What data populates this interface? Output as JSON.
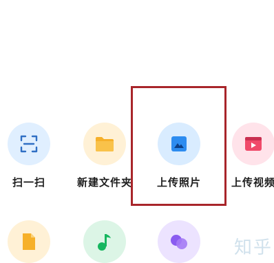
{
  "actions": [
    {
      "label": "扫一扫",
      "icon": "scan-icon",
      "bg": "#e0efff",
      "fg": "#2f6fc4"
    },
    {
      "label": "新建文件夹",
      "icon": "folder-icon",
      "bg": "#fff1d6",
      "fg": "#f6b02a"
    },
    {
      "label": "上传照片",
      "icon": "photo-icon",
      "bg": "#d9ecff",
      "fg": "#2d8cf0"
    },
    {
      "label": "上传视频",
      "icon": "video-icon",
      "bg": "#ffe3ea",
      "fg": "#f04a6a"
    }
  ],
  "second_row": [
    {
      "icon": "document-icon",
      "bg": "#fff1d6",
      "fg": "#f6b02a"
    },
    {
      "icon": "music-icon",
      "bg": "#dcf5e6",
      "fg": "#16b65f"
    },
    {
      "icon": "circles-icon",
      "bg": "#ece3ff",
      "fg": "#8a5cf0"
    }
  ],
  "highlight_color": "#a8252a",
  "watermark": "知乎"
}
